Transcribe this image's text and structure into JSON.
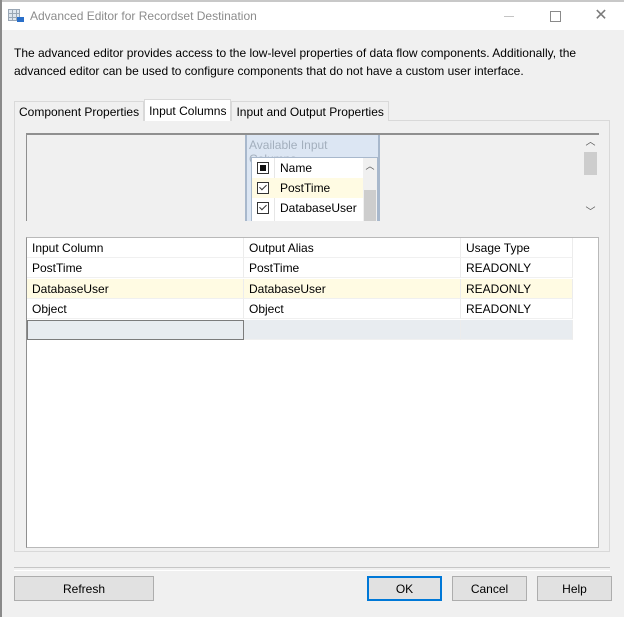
{
  "window": {
    "title": "Advanced Editor for Recordset Destination",
    "app_icon": "grid-table-icon",
    "controls": [
      "minimize",
      "maximize",
      "close"
    ]
  },
  "description": "The advanced editor provides access to the low-level properties of data flow components. Additionally, the advanced editor can be used to configure components that do not have a custom user interface.",
  "tabs": [
    {
      "label": "Component Properties",
      "active": false
    },
    {
      "label": "Input Columns",
      "active": true
    },
    {
      "label": "Input and Output Properties",
      "active": false
    }
  ],
  "available_columns": {
    "title": "Available Input Columns",
    "header": "Name",
    "items": [
      {
        "name": "PostTime",
        "checked": true
      },
      {
        "name": "DatabaseUser",
        "checked": true
      }
    ]
  },
  "grid": {
    "columns": [
      "Input Column",
      "Output Alias",
      "Usage Type"
    ],
    "rows": [
      {
        "input": "PostTime",
        "alias": "PostTime",
        "usage": "READONLY"
      },
      {
        "input": "DatabaseUser",
        "alias": "DatabaseUser",
        "usage": "READONLY"
      },
      {
        "input": "Object",
        "alias": "Object",
        "usage": "READONLY"
      }
    ]
  },
  "buttons": {
    "refresh": "Refresh",
    "ok": "OK",
    "cancel": "Cancel",
    "help": "Help"
  },
  "colors": {
    "accent": "#0078d7",
    "highlight_row": "#fffbe3",
    "new_row": "#e8ecf0"
  }
}
